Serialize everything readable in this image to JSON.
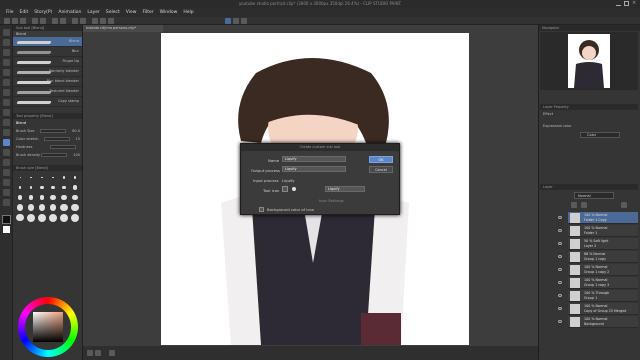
{
  "window": {
    "title": "youtube studio portrait.clip* (3000 x 3000px 350dpi 26.4%) - CLIP STUDIO PAINT"
  },
  "menu": [
    "File",
    "Edit",
    "Story(P)",
    "Animation",
    "Layer",
    "Select",
    "View",
    "Filter",
    "Window",
    "Help"
  ],
  "document_tab": "makoto niijima persona.clip*",
  "subtool": {
    "header": "Sub tool [Blend]",
    "group_label": "Blend",
    "brushes": [
      "Blend",
      "Blur",
      "Finger tip",
      "Painterly blender",
      "Blur blend blender",
      "Textured blender",
      "Copy stamp"
    ],
    "selected_index": 0
  },
  "tool_property": {
    "header": "Tool property [Blend]",
    "tool_label": "Blend",
    "rows": [
      {
        "label": "Brush Size",
        "value": "80.0"
      },
      {
        "label": "Color stretch",
        "value": "15"
      },
      {
        "label": "Hardness",
        "value": ""
      },
      {
        "label": "Brush density",
        "value": "100"
      }
    ]
  },
  "brush_size": {
    "header": "Brush size [Blend]",
    "sizes": [
      "0.7",
      "1",
      "1.5",
      "2",
      "2.5",
      "3",
      "4",
      "5",
      "6",
      "7",
      "8",
      "10",
      "12",
      "15",
      "17",
      "20",
      "25",
      "30",
      "40",
      "50",
      "60",
      "70",
      "80",
      "100",
      "120",
      "150",
      "170",
      "200",
      "250",
      "300"
    ]
  },
  "dialog": {
    "title": "Create custom sub tool",
    "name_label": "Name",
    "name_value": "Liquify",
    "output_label": "Output process",
    "output_value": "Liquify",
    "input_label": "Input process",
    "input_value": "Liquify",
    "toolicon_label": "Tool icon",
    "toolicon_value": "Liquify",
    "settings_label": "Icon Settings",
    "background_label": "Background color of icon",
    "ok_label": "OK",
    "cancel_label": "Cancel"
  },
  "right_panel": {
    "navigator_header": "Navigator",
    "layer_property_header": "Layer Property",
    "effect_label": "Effect",
    "expression_label": "Expression color",
    "expression_value": "Color",
    "layer_header": "Layer",
    "blend_mode": "Normal",
    "layers": [
      {
        "pct": "100 % Normal",
        "name": "Folder 1 Copy",
        "selected": true
      },
      {
        "pct": "100 % Normal",
        "name": "Folder 1",
        "selected": false
      },
      {
        "pct": "50 % Soft light",
        "name": "Layer 2",
        "selected": false
      },
      {
        "pct": "86 % Normal",
        "name": "Group 1 copy",
        "selected": false
      },
      {
        "pct": "100 % Normal",
        "name": "Group 1 copy 2",
        "selected": false
      },
      {
        "pct": "100 % Normal",
        "name": "Group 1 copy 3",
        "selected": false
      },
      {
        "pct": "100 % Through",
        "name": "Group 1",
        "selected": false
      },
      {
        "pct": "100 % Normal",
        "name": "Copy of Group 25 Merged",
        "selected": false
      },
      {
        "pct": "100 % Normal",
        "name": "Background",
        "selected": false
      }
    ]
  },
  "colors": {
    "accent": "#5b86c7",
    "selected_layer": "#4c6a96",
    "panel": "#353535"
  }
}
